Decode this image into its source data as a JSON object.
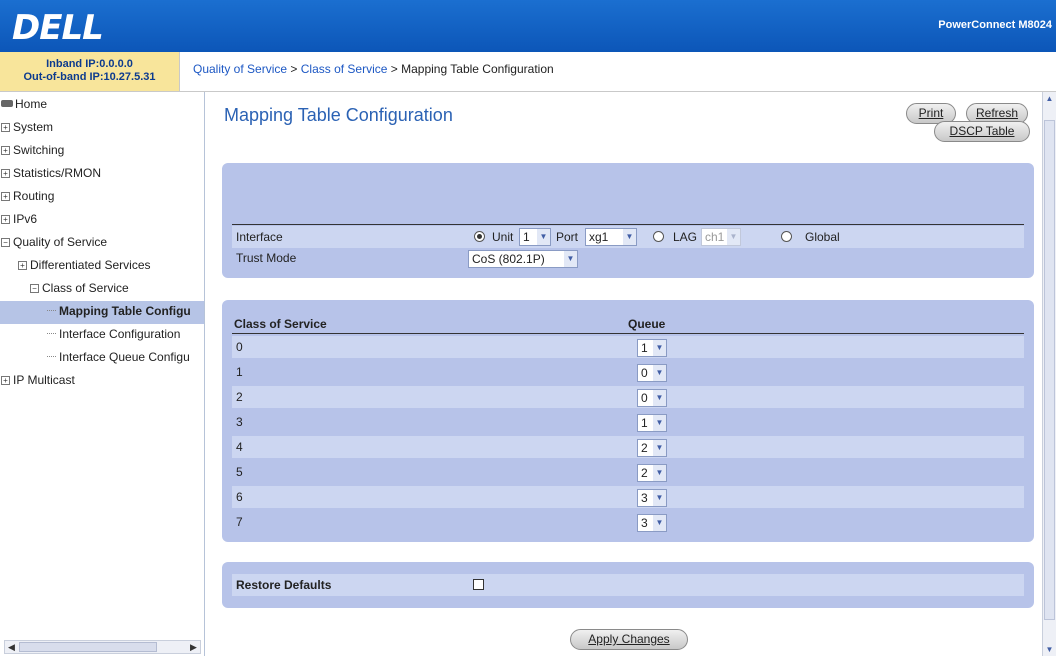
{
  "header": {
    "logo": "DELL",
    "product": "PowerConnect M8024"
  },
  "info": {
    "inband": "Inband IP:0.0.0.0",
    "oob": "Out-of-band IP:10.27.5.31"
  },
  "breadcrumb": {
    "part1": "Quality of Service",
    "sep1": " > ",
    "part2": "Class of Service",
    "sep2": " > ",
    "part3": "Mapping Table Configuration"
  },
  "sidebar": {
    "home": "Home",
    "system": "System",
    "switching": "Switching",
    "statistics": "Statistics/RMON",
    "routing": "Routing",
    "ipv6": "IPv6",
    "qos": "Quality of Service",
    "diffserv": "Differentiated Services",
    "cos": "Class of Service",
    "mapping": "Mapping Table Configu",
    "iface_conf": "Interface Configuration",
    "iface_queue": "Interface Queue Configu",
    "multicast": "IP Multicast"
  },
  "page": {
    "title": "Mapping Table Configuration",
    "print": "Print",
    "refresh": "Refresh",
    "dscp_table": "DSCP Table",
    "apply": "Apply Changes"
  },
  "interface": {
    "label": "Interface",
    "unit_label": "Unit",
    "unit_value": "1",
    "port_label": "Port",
    "port_value": "xg1",
    "lag_label": "LAG",
    "lag_value": "ch1",
    "global_label": "Global",
    "selected": "Unit"
  },
  "trust": {
    "label": "Trust Mode",
    "value": "CoS (802.1P)"
  },
  "mapping": {
    "col_cos": "Class of Service",
    "col_queue": "Queue",
    "rows": [
      {
        "cos": "0",
        "queue": "1"
      },
      {
        "cos": "1",
        "queue": "0"
      },
      {
        "cos": "2",
        "queue": "0"
      },
      {
        "cos": "3",
        "queue": "1"
      },
      {
        "cos": "4",
        "queue": "2"
      },
      {
        "cos": "5",
        "queue": "2"
      },
      {
        "cos": "6",
        "queue": "3"
      },
      {
        "cos": "7",
        "queue": "3"
      }
    ]
  },
  "restore": {
    "label": "Restore Defaults",
    "checked": false
  }
}
